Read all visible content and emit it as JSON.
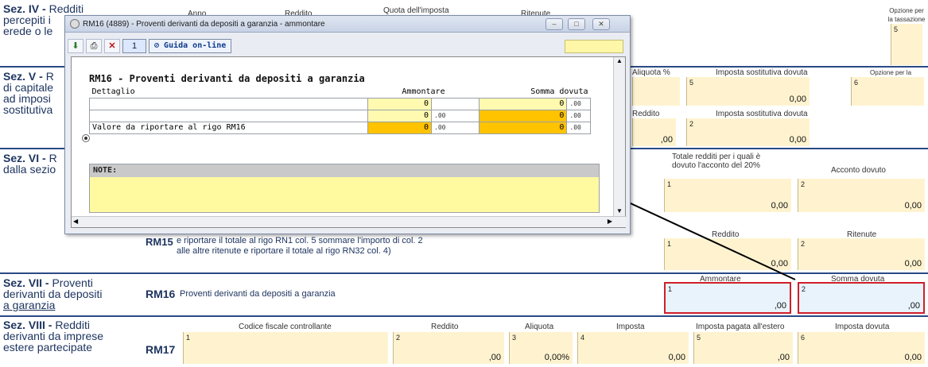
{
  "form": {
    "sections": [
      {
        "label": "Sez. IV - Redditi percepiti in qualità di erede o legatario",
        "line1": "Sez. IV -",
        "line1b": "Redditi",
        "line2": "percepiti i",
        "line3": "erede o le"
      },
      {
        "label": "Sez. V",
        "line1": "Sez. V -",
        "line1b": "R",
        "line2": "di capitale",
        "line3": "ad imposi",
        "line4": "sostitutiva"
      },
      {
        "label": "Sez. VI",
        "line1": "Sez. VI -",
        "line1b": "R",
        "line2": "dalla sezio"
      },
      {
        "label": "Sez. VII",
        "line1": "Sez. VII -",
        "line1b": "Proventi",
        "line2": "derivanti da depositi",
        "line3": "a garanzia"
      },
      {
        "label": "Sez. VIII",
        "line1": "Sez. VIII -",
        "line1b": "Redditi",
        "line2": "derivanti da imprese",
        "line3": "estere partecipate"
      }
    ],
    "top_headers": {
      "anno": "Anno",
      "reddito": "Reddito",
      "quota": "Quota dell'imposta",
      "ritenute": "Ritenute",
      "opzione": "Opzione per la tassazione ordinaria"
    },
    "sez5": {
      "aliq_hdr": "Aliquota %",
      "imposta_sost_hdr": "Imposta sostitutiva dovuta",
      "opzione_hdr": "Opzione per la tassazione ordinaria",
      "reddito_hdr": "Reddito",
      "imposta_sost_hdr2": "Imposta sostitutiva dovuta",
      "val1": "0,00",
      "val2": ",00",
      "val3": "0,00"
    },
    "sez6": {
      "totale_hdr": "Totale redditi per i quali è dovuto l'acconto del 20%",
      "acconto_hdr": "Acconto dovuto",
      "val1": "0,00",
      "val2": "0,00",
      "reddito_hdr": "Reddito",
      "ritenute_hdr": "Ritenute",
      "val3": "0,00",
      "val4": "0,00",
      "rm15_code": "RM15",
      "rm15_text1": "e riportare il totale al rigo RN1 col. 5 sommare l'importo di col. 2",
      "rm15_text2": "alle altre ritenute e riportare il totale al rigo RN32 col. 4)"
    },
    "sez7": {
      "code": "RM16",
      "text": "Proventi derivanti da depositi a garanzia",
      "ammontare_hdr": "Ammontare",
      "somma_hdr": "Somma dovuta",
      "val1": ",00",
      "val2": ",00"
    },
    "sez8": {
      "code": "RM17",
      "cf_hdr": "Codice fiscale controllante",
      "reddito_hdr": "Reddito",
      "aliquota_hdr": "Aliquota",
      "imposta_hdr": "Imposta",
      "estero_hdr": "Imposta pagata all'estero",
      "dovuta_hdr": "Imposta dovuta",
      "v_reddito": ",00",
      "v_aliquota": "0,00",
      "v_pct": "%",
      "v_imposta": "0,00",
      "v_estero": ",00",
      "v_dovuta": "0,00"
    }
  },
  "dialog": {
    "title": "RM16 (4889) - Proventi derivanti da depositi a garanzia - ammontare",
    "page": "1",
    "guide": "Guida on-line",
    "heading": "RM16 - Proventi derivanti da depositi a garanzia",
    "col_dettaglio": "Dettaglio",
    "col_ammontare": "Ammontare",
    "col_somma": "Somma dovuta",
    "rows": [
      {
        "label": "",
        "amm": "0",
        "amm_c": ".00",
        "som": "0",
        "som_c": ".00"
      },
      {
        "label": "",
        "amm": "0",
        "amm_c": ".00",
        "som": "0",
        "som_c": ".00"
      },
      {
        "label": "Valore da riportare al rigo RM16",
        "amm": "0",
        "amm_c": ".00",
        "som": "0",
        "som_c": ".00"
      }
    ],
    "notes_label": "NOTE:",
    "notes_value": ""
  }
}
